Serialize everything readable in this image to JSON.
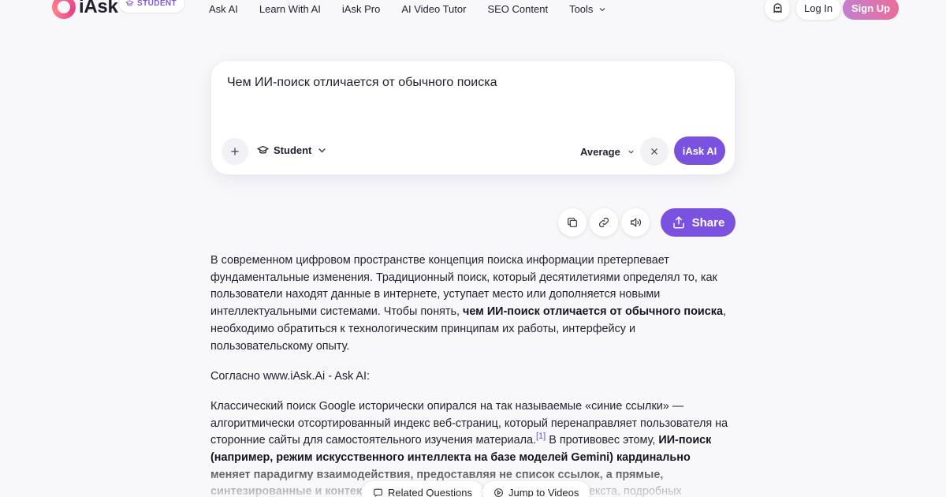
{
  "header": {
    "logo_text": "iAsk",
    "student_badge": "STUDENT",
    "nav": [
      {
        "label": "Ask AI"
      },
      {
        "label": "Learn With AI"
      },
      {
        "label": "iAsk Pro"
      },
      {
        "label": "AI Video Tutor"
      },
      {
        "label": "SEO Content"
      },
      {
        "label": "Tools",
        "icon": "chevron-down-icon"
      }
    ],
    "login_label": "Log In",
    "signup_label": "Sign Up"
  },
  "query": {
    "text": "Чем ИИ-поиск отличается от обычного поиска",
    "mode_label": "Student",
    "level_label": "Average",
    "submit_label": "iAsk AI"
  },
  "actions": {
    "share_label": "Share"
  },
  "article": {
    "p1_a": "В современном цифровом пространстве концепция поиска информации претерпевает фундаментальные изменения. Традиционный поиск, который десятилетиями определял то, как пользователи находят данные в интернете, уступает место или дополняется новыми интеллектуальными системами. Чтобы понять, ",
    "p1_b": "чем ИИ-поиск отличается от обычного поиска",
    "p1_c": ", необходимо обратиться к технологическим принципам их работы, интерфейсу и пользовательскому опыту.",
    "p2": "Согласно www.iAsk.Ai - Ask AI:",
    "p3_a": "Классический поиск Google исторически опирался на так называемые «синие ссылки» — алгоритмически отсортированный индекс веб-страниц, который перенаправляет пользователя на сторонние сайты для самостоятельного изучения материала.",
    "p3_cite": "[1]",
    "p3_b": " В противовес этому, ",
    "p3_c": "ИИ-поиск (например, режим искусственного интеллекта на базе моделей Gemini) кардинально меняет парадигму взаимодействия, предоставляя не список ссылок, а прямые, синтезированные и контекстуальные ответы в виде",
    "p3_d": " развернутого текста, подробных"
  },
  "bottom_chips": {
    "related_label": "Related Questions",
    "jump_label": "Jump to Videos"
  },
  "colors": {
    "accent": "#7b52e0",
    "signup_gradient_start": "#c47fcf",
    "signup_gradient_end": "#ea6d9b",
    "background": "#f8f8fb"
  }
}
